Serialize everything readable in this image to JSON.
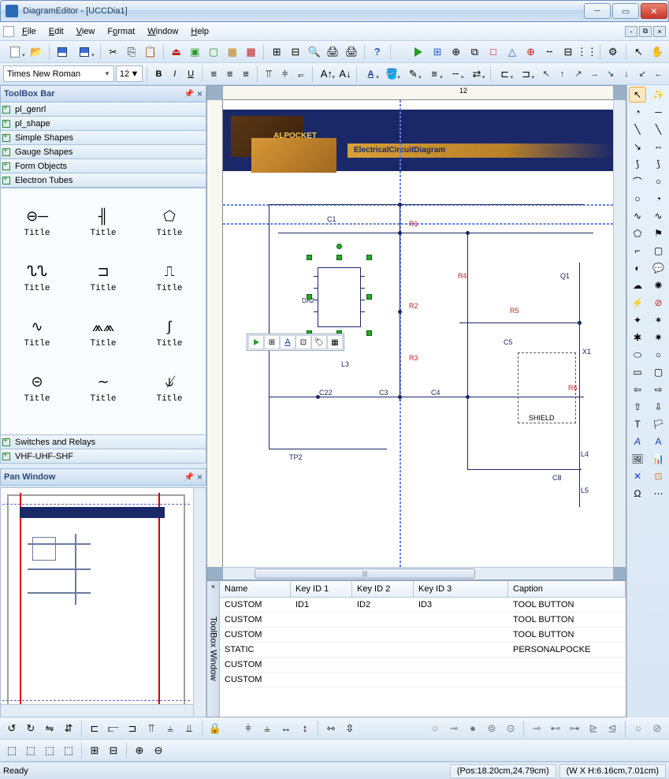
{
  "title": "DiagramEditor - [UCCDia1]",
  "menus": [
    "File",
    "Edit",
    "View",
    "Format",
    "Window",
    "Help"
  ],
  "font": {
    "name": "Times New Roman",
    "size": "12"
  },
  "toolbox": {
    "title": "ToolBox Bar",
    "items_top": [
      "pl_genrl",
      "pl_shape",
      "Simple Shapes",
      "Gauge Shapes",
      "Form Objects",
      "Electron Tubes"
    ],
    "items_bottom": [
      "Switches and Relays",
      "VHF-UHF-SHF"
    ],
    "symbol_label": "Title"
  },
  "pan": {
    "title": "Pan Window"
  },
  "diagram": {
    "banner_sub": "ALPOCKET",
    "banner_main": "ElectricalCircuitDiagram",
    "shield": "SHIELD",
    "components": {
      "C1": "C1",
      "C3": "C3",
      "C4": "C4",
      "C5": "C5",
      "C8": "C8",
      "C22": "C22",
      "R1": "R1",
      "R2": "R2",
      "R3": "R3",
      "R4": "R4",
      "R5": "R5",
      "R6": "R6",
      "L3": "L3",
      "L4": "L4",
      "L5": "L5",
      "Q1": "Q1",
      "X1": "X1",
      "TP2": "TP2",
      "DA2": "DA2"
    }
  },
  "ruler": {
    "mark12": "12"
  },
  "properties": {
    "title": "ToolBox Window",
    "headers": {
      "name": "Name",
      "k1": "Key ID 1",
      "k2": "Key ID 2",
      "k3": "Key ID 3",
      "cap": "Caption"
    },
    "rows": [
      {
        "name": "CUSTOM",
        "k1": "ID1",
        "k2": "ID2",
        "k3": "ID3",
        "cap": "TOOL BUTTON"
      },
      {
        "name": "CUSTOM",
        "k1": "",
        "k2": "",
        "k3": "",
        "cap": "TOOL BUTTON"
      },
      {
        "name": "CUSTOM",
        "k1": "",
        "k2": "",
        "k3": "",
        "cap": "TOOL BUTTON"
      },
      {
        "name": "STATIC",
        "k1": "",
        "k2": "",
        "k3": "",
        "cap": "PERSONALPOCKE"
      },
      {
        "name": "CUSTOM",
        "k1": "",
        "k2": "",
        "k3": "",
        "cap": ""
      },
      {
        "name": "CUSTOM",
        "k1": "",
        "k2": "",
        "k3": "",
        "cap": ""
      }
    ]
  },
  "status": {
    "ready": "Ready",
    "pos": "(Pos:18.20cm,24.79cm)",
    "size": "(W X H:6.16cm,7.01cm)"
  }
}
